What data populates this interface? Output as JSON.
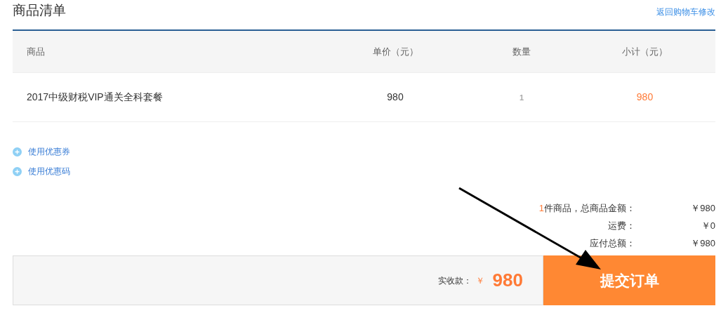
{
  "title": "商品清单",
  "back_link": "返回购物车修改",
  "table": {
    "columns": [
      "商品",
      "单价（元）",
      "数量",
      "小计（元）"
    ],
    "rows": [
      {
        "product": "2017中级财税VIP通关全科套餐",
        "price": "980",
        "quantity": "1",
        "subtotal": "980"
      }
    ]
  },
  "discounts": [
    {
      "label": "使用优惠券"
    },
    {
      "label": "使用优惠码"
    }
  ],
  "summary": [
    {
      "count": "1",
      "label": "件商品，总商品金额：",
      "value": "￥980"
    },
    {
      "label": "运费：",
      "value": "￥0"
    },
    {
      "label": "应付总额：",
      "value": "￥980"
    }
  ],
  "payment": {
    "label": "实收款：",
    "currency": "￥",
    "amount": "980"
  },
  "submit_button": "提交订单"
}
